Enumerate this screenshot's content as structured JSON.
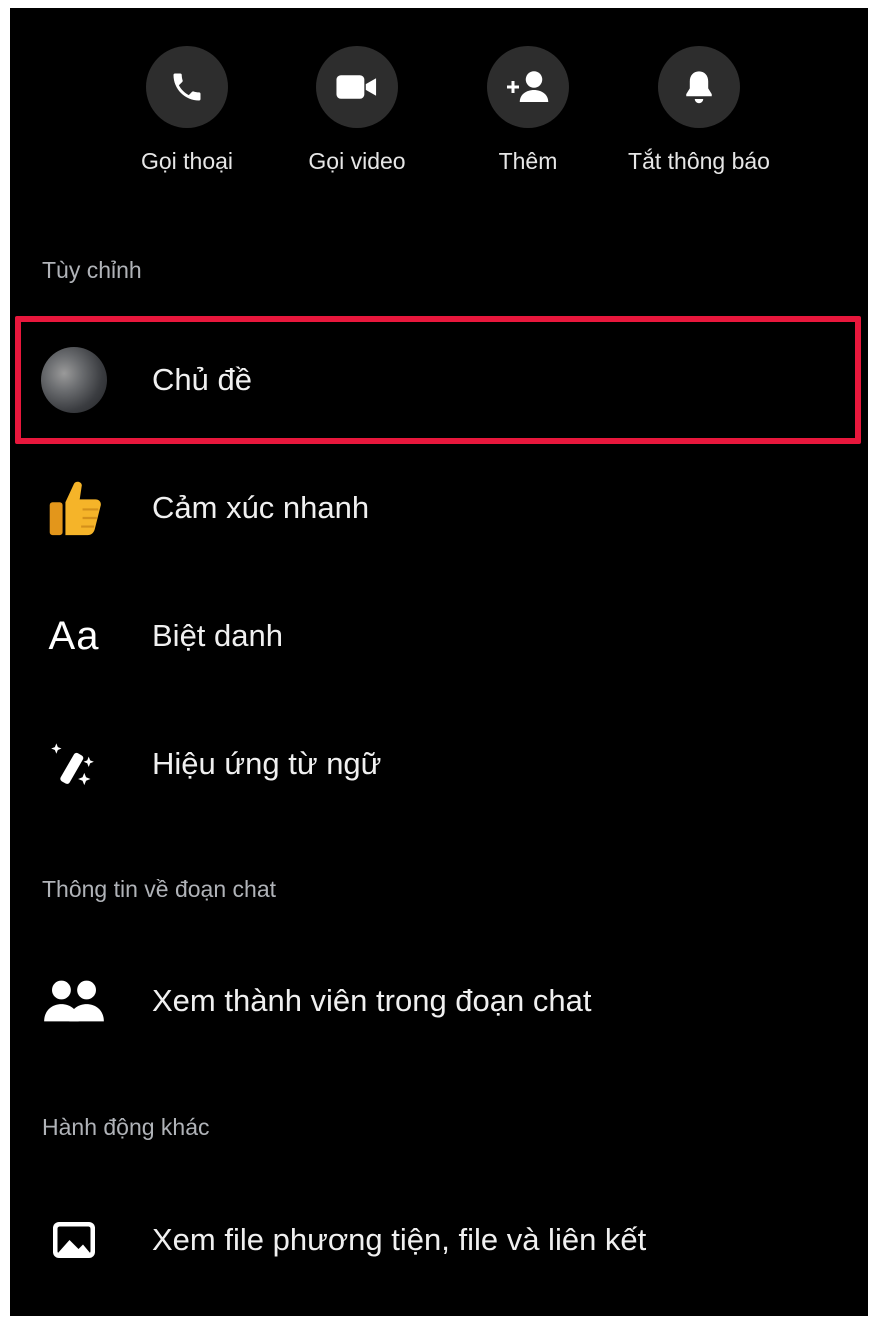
{
  "actions": [
    {
      "icon": "phone-icon",
      "label": "Gọi thoại"
    },
    {
      "icon": "video-camera-icon",
      "label": "Gọi video"
    },
    {
      "icon": "add-person-icon",
      "label": "Thêm"
    },
    {
      "icon": "bell-icon",
      "label": "Tắt thông báo"
    }
  ],
  "sections": {
    "customize": "Tùy chỉnh",
    "chat_info": "Thông tin về đoạn chat",
    "other_actions": "Hành động khác"
  },
  "rows": {
    "theme": {
      "icon": "theme-avatar-icon",
      "label": "Chủ đề"
    },
    "quick_reaction": {
      "icon": "thumbs-up-icon",
      "label": "Cảm xúc nhanh"
    },
    "nicknames": {
      "icon": "text-aa-icon",
      "icon_text": "Aa",
      "label": "Biệt danh"
    },
    "word_effects": {
      "icon": "magic-wand-icon",
      "label": "Hiệu ứng từ ngữ"
    },
    "members": {
      "icon": "people-icon",
      "label": "Xem thành viên trong đoạn chat"
    },
    "media": {
      "icon": "image-icon",
      "label": "Xem file phương tiện, file và liên kết"
    }
  },
  "colors": {
    "background": "#000000",
    "button_circle": "#2d2d2d",
    "section_text": "#b0b3b8",
    "highlight": "#e8173c",
    "thumb": "#f5b429"
  }
}
